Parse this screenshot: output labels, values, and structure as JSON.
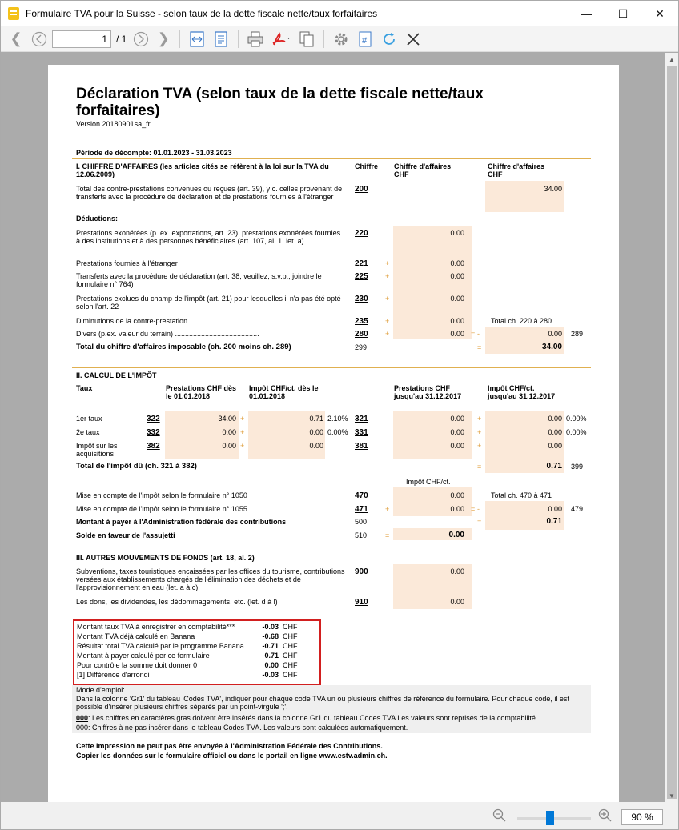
{
  "window": {
    "title": "Formulaire TVA pour la Suisse - selon taux de la dette fiscale nette/taux forfaitaires",
    "min": "—",
    "max": "☐",
    "close": "✕"
  },
  "toolbar": {
    "page_value": "1",
    "page_total": "/ 1"
  },
  "status": {
    "zoom": "90 %"
  },
  "doc": {
    "title": "Déclaration TVA (selon taux de la dette fiscale nette/taux forfaitaires)",
    "version": "Version 20180901sa_fr",
    "period": "Période de décompte: 01.01.2023 - 31.03.2023",
    "s1": {
      "head": "I. CHIFFRE D'AFFAIRES (les articles cités se réfèrent à la loi sur la TVA du 12.06.2009)",
      "col_code": "Chiffre",
      "col_ca1": "Chiffre d'affaires CHF",
      "col_ca2": "Chiffre d'affaires CHF",
      "rows": [
        {
          "label": "Total des contre-prestations convenues ou reçues (art. 39), y c. celles provenant de transferts avec la procédure de déclaration et de prestations fournies à l'étranger",
          "code": "200",
          "v2": "34.00"
        },
        {
          "label": "Déductions:"
        },
        {
          "label": "Prestations exonérées (p. ex. exportations, art. 23), prestations exonérées fournies à des institutions et à des personnes bénéficiaires (art. 107, al. 1, let. a)",
          "code": "220",
          "v1": "0.00"
        },
        {
          "label": "Prestations fournies à l'étranger",
          "code": "221",
          "op": "+",
          "v1": "0.00"
        },
        {
          "label": "Transferts avec la procédure de déclaration (art. 38, veuillez, s.v.p., joindre le formulaire n° 764)",
          "code": "225",
          "op": "+",
          "v1": "0.00"
        },
        {
          "label": "Prestations exclues du champ de l'impôt (art. 21) pour lesquelles il n'a pas été opté selon l'art. 22",
          "code": "230",
          "op": "+",
          "v1": "0.00"
        },
        {
          "label": "Diminutions de la contre-prestation",
          "code": "235",
          "op": "+",
          "v1": "0.00",
          "note": "Total ch. 220 à 280"
        },
        {
          "label": "Divers (p.ex. valeur du terrain) ..........................................",
          "code": "280",
          "op": "+",
          "v1": "0.00",
          "op2": "=",
          "op3": "-",
          "v2": "0.00",
          "ref": "289"
        },
        {
          "label": "Total du chiffre d'affaires imposable (ch. 200 moins ch. 289)",
          "code": "299",
          "op": "=",
          "v2": "34.00"
        }
      ]
    },
    "s2": {
      "head": "II. CALCUL DE L'IMPÔT",
      "taux": "Taux",
      "c1": "Prestations CHF dès le 01.01.2018",
      "c2": "Impôt CHF/ct. dès le 01.01.2018",
      "c3": "Prestations CHF jusqu'au 31.12.2017",
      "c4": "Impôt CHF/ct. jusqu'au 31.12.2017",
      "rows": [
        {
          "label": "1er taux",
          "code": "322",
          "p": "34.00",
          "i": "0.71",
          "rate": "2.10%",
          "code2": "321",
          "p2": "0.00",
          "i2": "0.00",
          "rate2": "0.00%"
        },
        {
          "label": "2e taux",
          "code": "332",
          "p": "0.00",
          "i": "0.00",
          "rate": "0.00%",
          "code2": "331",
          "p2": "0.00",
          "i2": "0.00",
          "rate2": "0.00%"
        },
        {
          "label": "Impôt sur les acquisitions",
          "code": "382",
          "p": "0.00",
          "i": "0.00",
          "code2": "381",
          "p2": "0.00",
          "i2": "0.00"
        }
      ],
      "total_label": "Total de l'impôt dû (ch. 321 à 382)",
      "total": "0.71",
      "total_ref": "399",
      "impot_head": "Impôt CHF/ct.",
      "m1": {
        "label": "Mise en compte de l'impôt selon le formulaire n° 1050",
        "code": "470",
        "v": "0.00",
        "note": "Total ch. 470 à 471"
      },
      "m2": {
        "label": "Mise en compte de l'impôt selon le formulaire n° 1055",
        "code": "471",
        "v": "0.00",
        "v2": "0.00",
        "ref": "479"
      },
      "m3": {
        "label": "Montant à payer à l'Administration fédérale des contributions",
        "code": "500",
        "v2": "0.71"
      },
      "m4": {
        "label": "Solde en faveur de l'assujetti",
        "code": "510",
        "v": "0.00"
      }
    },
    "s3": {
      "head": "III. AUTRES MOUVEMENTS DE FONDS (art. 18, al. 2)",
      "r1": {
        "label": "Subventions, taxes touristiques encaissées par les offices du tourisme, contributions versées aux établissements chargés de l'élimination des déchets et de l'approvisionnement en eau (let. a à c)",
        "code": "900",
        "v": "0.00"
      },
      "r2": {
        "label": "Les dons, les dividendes, les dédommagements, etc. (let. d à l)",
        "code": "910",
        "v": "0.00"
      }
    },
    "summary": [
      {
        "label": "Montant taux TVA à enregistrer en comptabilité***",
        "v": "-0.03",
        "u": "CHF"
      },
      {
        "label": "Montant TVA déjà calculé en Banana",
        "v": "-0.68",
        "u": "CHF"
      },
      {
        "label": "Résultat total TVA calculé par le programme Banana",
        "v": "-0.71",
        "u": "CHF"
      },
      {
        "label": "Montant à payer calculé per ce formulaire",
        "v": "0.71",
        "u": "CHF"
      },
      {
        "label": "Pour contrôle la somme doit donner 0",
        "v": "0.00",
        "u": "CHF"
      },
      {
        "label": "[1] Différence d'arrondi",
        "v": "-0.03",
        "u": "CHF"
      }
    ],
    "mode": {
      "title": "Mode d'emploi:",
      "l1": "Dans la colonne 'Gr1' du tableau 'Codes TVA', indiquer pour chaque code TVA un ou plusieurs chiffres de référence du formulaire. Pour chaque code, il est possible d'insérer plusieurs chiffres séparés par un point-virgule ';'.",
      "l2b": "000",
      "l2": ": Les chiffres en caractères gras doivent être insérés dans la colonne Gr1 du tableau Codes TVA Les valeurs sont reprises de la comptabilité.",
      "l3b": "000",
      "l3": ": Chiffres à ne pas insérer dans le tableau Codes TVA. Les valeurs sont calculées automatiquement."
    },
    "footer1": "Cette impression ne peut pas être envoyée à l'Administration Fédérale des Contributions.",
    "footer2": "Copier les données sur le formulaire officiel ou dans le portail en ligne www.estv.admin.ch."
  }
}
